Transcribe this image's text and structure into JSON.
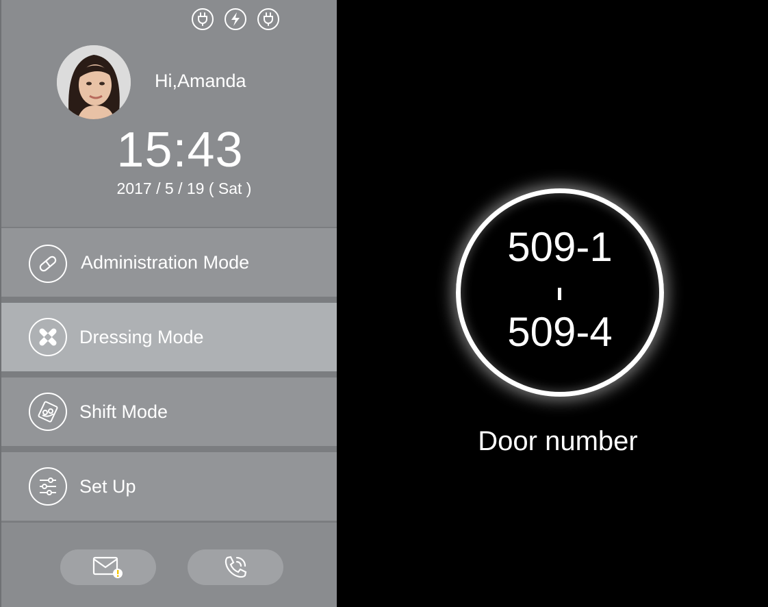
{
  "user": {
    "greeting": "Hi,Amanda"
  },
  "clock": {
    "time": "15:43",
    "date": "2017 / 5 / 19 ( Sat )"
  },
  "status_icons": [
    "plug-icon",
    "lightning-icon",
    "plug-icon"
  ],
  "menu": [
    {
      "label": "Administration Mode",
      "icon": "pill-icon",
      "selected": false
    },
    {
      "label": "Dressing Mode",
      "icon": "bandage-icon",
      "selected": true
    },
    {
      "label": "Shift Mode",
      "icon": "handshake-icon",
      "selected": false
    },
    {
      "label": "Set Up",
      "icon": "sliders-icon",
      "selected": false
    }
  ],
  "bottom_buttons": [
    {
      "icon": "mail-alert-icon"
    },
    {
      "icon": "phone-call-icon"
    }
  ],
  "door": {
    "from": "509-1",
    "to": "509-4",
    "label": "Door number"
  },
  "colors": {
    "sidebar": "#8a8c8f",
    "menu_item": "#939598",
    "menu_selected": "#aeb1b4",
    "divider": "#7b7d80",
    "background": "#000000",
    "text": "#ffffff"
  }
}
